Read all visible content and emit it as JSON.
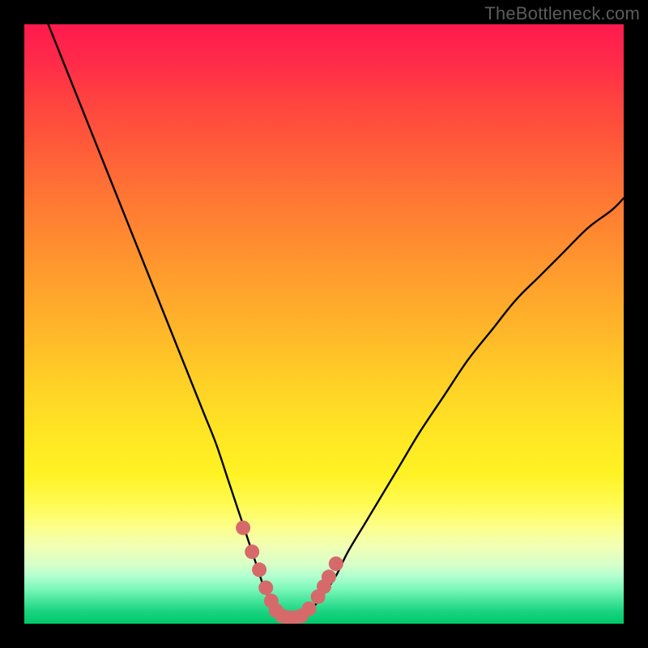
{
  "watermark": "TheBottleneck.com",
  "colors": {
    "background": "#000000",
    "curve": "#000000",
    "marker_fill": "#d66a6a",
    "marker_stroke": "#b94e4e"
  },
  "chart_data": {
    "type": "line",
    "title": "",
    "xlabel": "",
    "ylabel": "",
    "xlim": [
      0,
      100
    ],
    "ylim": [
      0,
      100
    ],
    "x": [
      4,
      6,
      8,
      10,
      12,
      14,
      16,
      18,
      20,
      22,
      24,
      26,
      28,
      30,
      32,
      34,
      35,
      36,
      37,
      38,
      39,
      40,
      41,
      42,
      43,
      44,
      45,
      46,
      47,
      48,
      50,
      52,
      54,
      57,
      60,
      63,
      66,
      70,
      74,
      78,
      82,
      86,
      90,
      94,
      98,
      100
    ],
    "y": [
      100,
      95,
      90,
      85,
      80,
      75,
      70,
      65,
      60,
      55,
      50,
      45,
      40,
      35,
      30,
      24,
      21,
      18,
      15,
      12,
      9,
      6,
      4,
      2.5,
      1.5,
      1,
      1,
      1,
      1.5,
      2.5,
      5,
      8,
      12,
      17,
      22,
      27,
      32,
      38,
      44,
      49,
      54,
      58,
      62,
      66,
      69,
      71
    ],
    "markers": {
      "x": [
        36.5,
        38,
        39.2,
        40.3,
        41.2,
        42,
        43,
        44,
        45,
        46.2,
        47.5,
        49,
        50,
        50.8,
        52
      ],
      "y": [
        16,
        12,
        9,
        6,
        3.8,
        2.2,
        1.3,
        1,
        1,
        1.3,
        2.5,
        4.5,
        6.2,
        7.8,
        10
      ]
    }
  }
}
